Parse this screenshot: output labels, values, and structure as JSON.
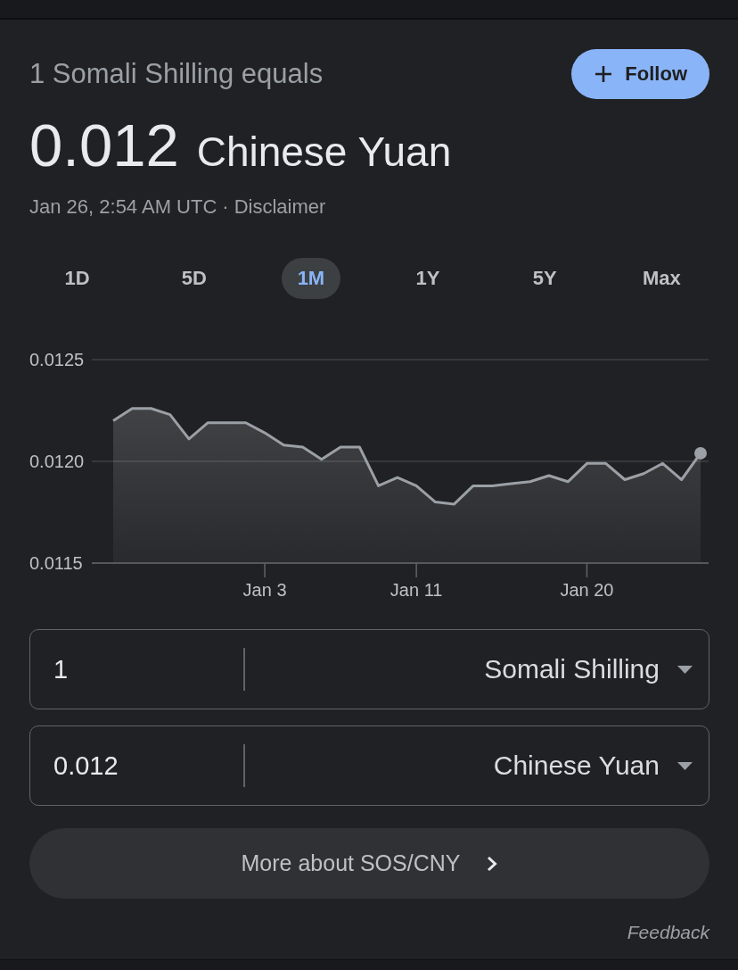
{
  "header": {
    "subtitle": "1 Somali Shilling equals",
    "follow_button": {
      "label": "Follow"
    }
  },
  "rate": {
    "value": "0.012",
    "currency": "Chinese Yuan"
  },
  "meta": {
    "timestamp": "Jan 26, 2:54 AM UTC",
    "separator": "·",
    "disclaimer_link": "Disclaimer"
  },
  "ranges": [
    {
      "label": "1D",
      "selected": false
    },
    {
      "label": "5D",
      "selected": false
    },
    {
      "label": "1M",
      "selected": true
    },
    {
      "label": "1Y",
      "selected": false
    },
    {
      "label": "5Y",
      "selected": false
    },
    {
      "label": "Max",
      "selected": false
    }
  ],
  "chart": {
    "chart_data": {
      "type": "area",
      "categories": [
        null,
        null,
        null,
        null,
        null,
        null,
        null,
        null,
        "Jan 3",
        null,
        null,
        null,
        null,
        null,
        null,
        null,
        "Jan 11",
        null,
        null,
        null,
        null,
        null,
        null,
        null,
        null,
        "Jan 20",
        null,
        null,
        null,
        null,
        null,
        null
      ],
      "series": [
        {
          "color": "#9aa0a6",
          "values": [
            0.0122,
            0.01226,
            0.01226,
            0.01223,
            0.01211,
            0.01219,
            0.01219,
            0.01219,
            0.01214,
            0.01208,
            0.01207,
            0.01201,
            0.01207,
            0.01207,
            0.01188,
            0.01192,
            0.01188,
            0.0118,
            0.01179,
            0.01188,
            0.01188,
            0.01189,
            0.0119,
            0.01193,
            0.0119,
            0.01199,
            0.01199,
            0.01191,
            0.01194,
            0.01199,
            0.01191,
            0.01204
          ]
        }
      ],
      "ylim": [
        0.0115,
        0.0125
      ],
      "yticks": [
        {
          "value": 0.0115,
          "label": "0.0115"
        },
        {
          "value": 0.012,
          "label": "0.0120"
        },
        {
          "value": 0.0125,
          "label": "0.0125"
        }
      ]
    }
  },
  "converter": [
    {
      "amount": "1",
      "currency": "Somali Shilling"
    },
    {
      "amount": "0.012",
      "currency": "Chinese Yuan"
    }
  ],
  "more_button": {
    "label": "More about SOS/CNY"
  },
  "feedback_link": "Feedback"
}
